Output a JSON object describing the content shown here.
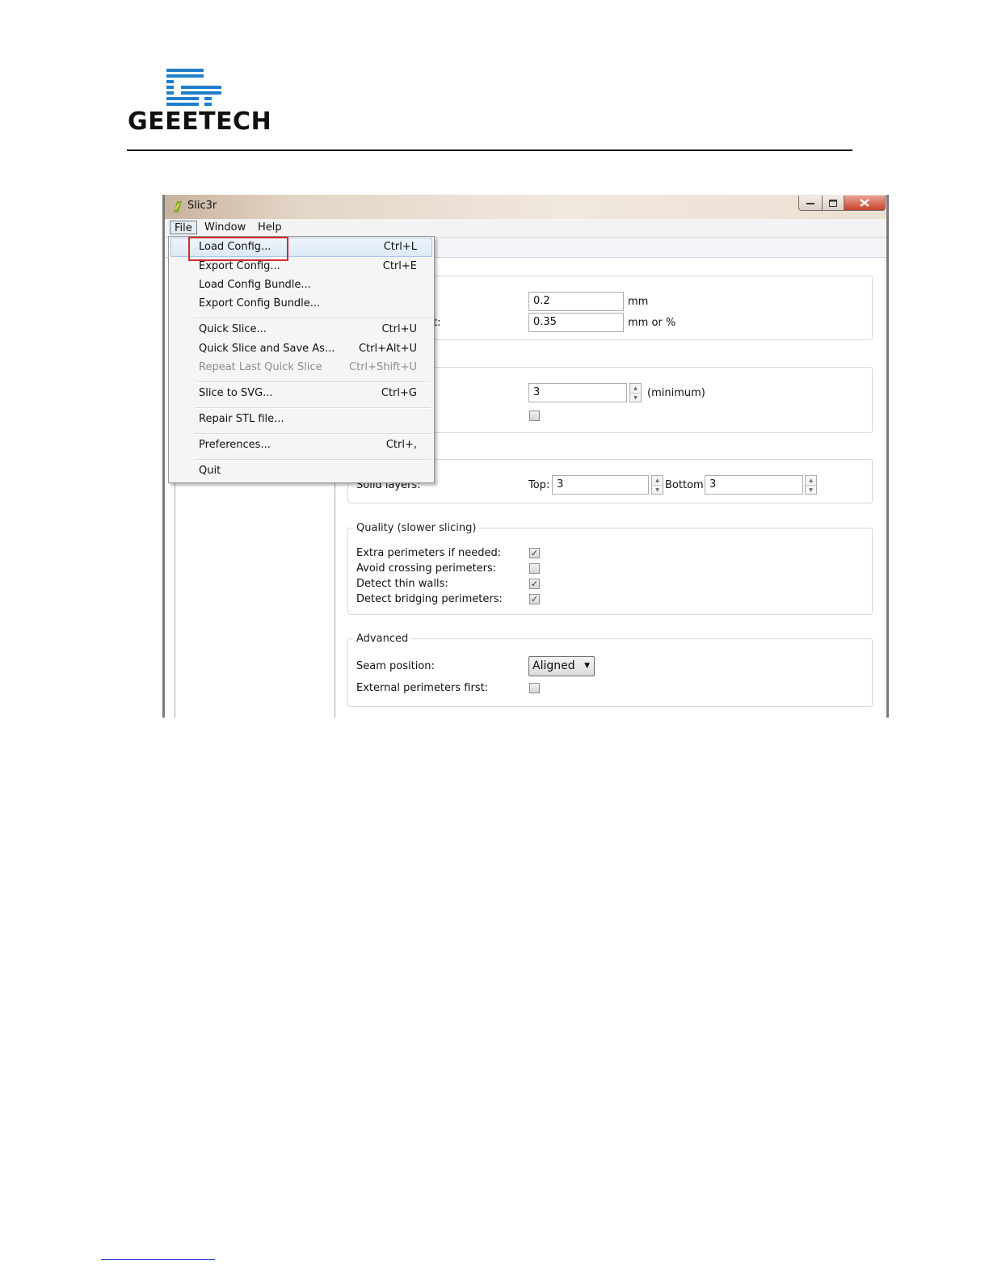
{
  "logo": {
    "text": "GEEETECH"
  },
  "window": {
    "title": "Slic3r",
    "menubar": [
      "File",
      "Window",
      "Help"
    ]
  },
  "file_menu": {
    "items": [
      {
        "label": "Load Config...",
        "shortcut": "Ctrl+L"
      },
      {
        "label": "Export Config...",
        "shortcut": "Ctrl+E"
      },
      {
        "label": "Load Config Bundle...",
        "shortcut": ""
      },
      {
        "label": "Export Config Bundle...",
        "shortcut": ""
      },
      {
        "label": "Quick Slice...",
        "shortcut": "Ctrl+U"
      },
      {
        "label": "Quick Slice and Save As...",
        "shortcut": "Ctrl+Alt+U"
      },
      {
        "label": "Repeat Last Quick Slice",
        "shortcut": "Ctrl+Shift+U",
        "disabled": true
      },
      {
        "label": "Slice to SVG...",
        "shortcut": "Ctrl+G"
      },
      {
        "label": "Repair STL file...",
        "shortcut": ""
      },
      {
        "label": "Preferences...",
        "shortcut": "Ctrl+,"
      },
      {
        "label": "Quit",
        "shortcut": ""
      }
    ]
  },
  "layer_height": {
    "first_layer_label_tail": "t:",
    "value": "0.2",
    "unit": "mm",
    "first_value": "0.35",
    "first_unit": "mm or %"
  },
  "perimeters": {
    "value": "3",
    "note": "(minimum)",
    "spiral_checked": false
  },
  "horizontal_shells": {
    "label": "Solid layers:",
    "top_label": "Top:",
    "top_value": "3",
    "bottom_label": "Bottom:",
    "bottom_value": "3"
  },
  "quality": {
    "legend": "Quality (slower slicing)",
    "items": [
      {
        "label": "Extra perimeters if needed:",
        "checked": true
      },
      {
        "label": "Avoid crossing perimeters:",
        "checked": false
      },
      {
        "label": "Detect thin walls:",
        "checked": true
      },
      {
        "label": "Detect bridging perimeters:",
        "checked": true
      }
    ]
  },
  "advanced": {
    "legend": "Advanced",
    "seam_label": "Seam position:",
    "seam_value": "Aligned",
    "ext_first_label": "External perimeters first:",
    "ext_first_checked": false
  },
  "colors": {
    "highlight_box": "#d52b2b",
    "logo_blue": "#1f7ec9",
    "link_rule": "#2b3bd6"
  }
}
